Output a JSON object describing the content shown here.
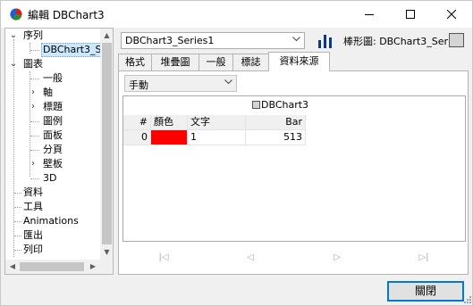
{
  "window": {
    "title": "編輯 DBChart3",
    "controls": {
      "minimize": "—",
      "maximize": "☐",
      "close": "✕"
    }
  },
  "tree": {
    "items": [
      {
        "label": "序列",
        "expander": "v",
        "level": 0
      },
      {
        "label": "DBChart3_Se",
        "level": 1,
        "selected": true
      },
      {
        "label": "圖表",
        "expander": "v",
        "level": 0
      },
      {
        "label": "一般",
        "level": 1
      },
      {
        "label": "軸",
        "expander": ">",
        "level": 1
      },
      {
        "label": "標題",
        "expander": ">",
        "level": 1
      },
      {
        "label": "圖例",
        "level": 1
      },
      {
        "label": "面板",
        "level": 1
      },
      {
        "label": "分頁",
        "level": 1
      },
      {
        "label": "壁板",
        "expander": ">",
        "level": 1
      },
      {
        "label": "3D",
        "level": 1
      },
      {
        "label": "資料",
        "level": 0
      },
      {
        "label": "工具",
        "level": 0
      },
      {
        "label": "Animations",
        "level": 0
      },
      {
        "label": "匯出",
        "level": 0
      },
      {
        "label": "列印",
        "level": 0
      }
    ]
  },
  "series_selector": {
    "value": "DBChart3_Series1",
    "type_label": "棒形圖: DBChart3_Serie"
  },
  "tabs": [
    {
      "label": "格式",
      "active": false
    },
    {
      "label": "堆疊圖",
      "active": false
    },
    {
      "label": "一般",
      "active": false
    },
    {
      "label": "標誌",
      "active": false
    },
    {
      "label": "資料來源",
      "active": true
    }
  ],
  "datasource": {
    "mode": "手動",
    "grid": {
      "chart_header": "DBChart3",
      "columns": [
        "#",
        "顏色",
        "文字",
        "Bar"
      ],
      "rows": [
        {
          "index": "0",
          "color": "#ff0000",
          "text": "1",
          "value": "513"
        }
      ]
    },
    "nav": [
      "|◁",
      "◁",
      "▷",
      "▷|"
    ]
  },
  "buttons": {
    "close": "關閉"
  },
  "colors": {
    "accent": "#0078d7",
    "selection": "#cce8ff",
    "row_color": "#ff0000"
  }
}
